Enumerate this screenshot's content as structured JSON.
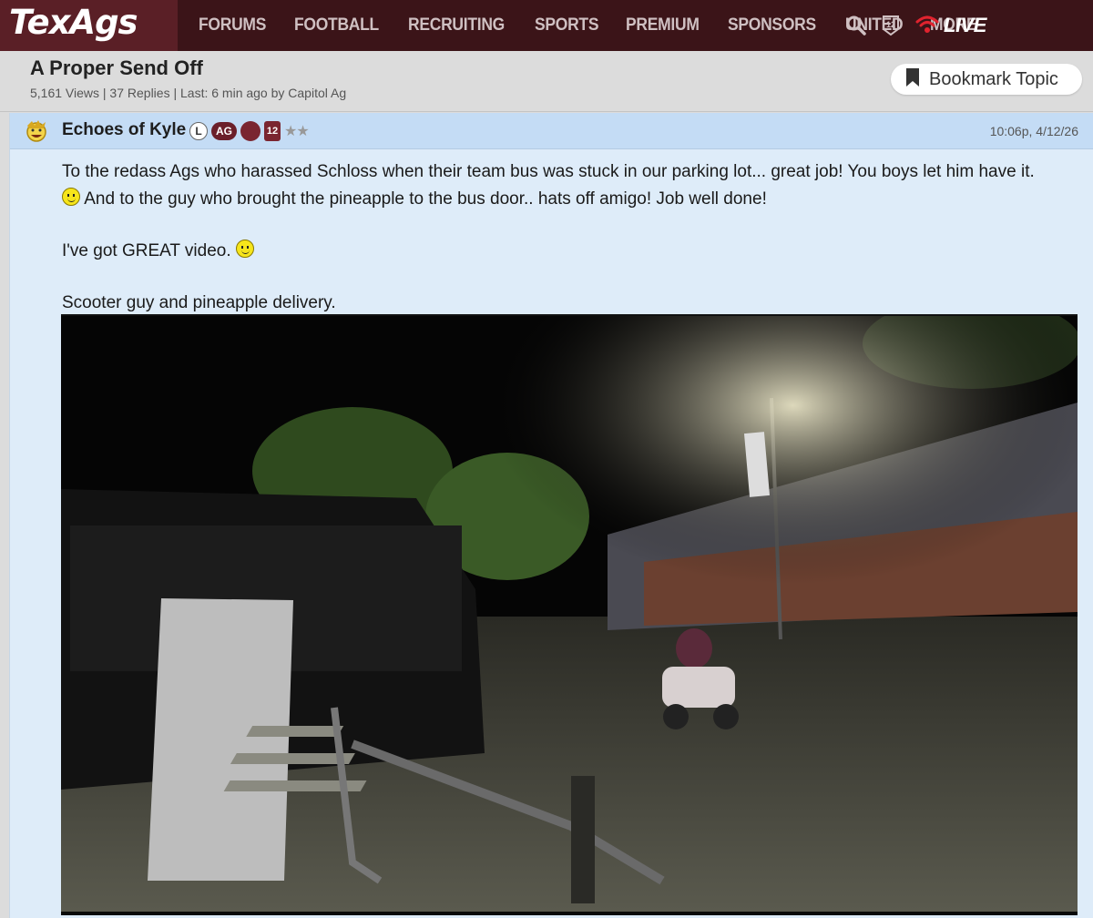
{
  "brand": {
    "logo_text": "TexAgs",
    "primary_color": "#3b1418",
    "accent_color": "#5a1f26"
  },
  "nav": {
    "items": [
      "FORUMS",
      "FOOTBALL",
      "RECRUITING",
      "SPORTS",
      "PREMIUM",
      "SPONSORS",
      "UNITED",
      "MORE"
    ],
    "live_label": "LIVE",
    "icons": [
      "search-icon",
      "sec-logo-icon",
      "live-signal-icon"
    ]
  },
  "topic": {
    "title": "A Proper Send Off",
    "meta": "5,161 Views | 37 Replies | Last: 6 min ago by Capitol Ag",
    "bookmark_label": "Bookmark Topic"
  },
  "post": {
    "username": "Echoes of Kyle",
    "badge_l": "L",
    "badge_ag": "AG",
    "badge_12": "12",
    "stars": "★★",
    "timestamp": "10:06p, 4/12/26",
    "line1": "To the redass Ags who harassed Schloss when their team bus was stuck in our parking lot... great job! You boys let him have it.",
    "line2": " And to the guy who brought the pineapple to the bus door.. hats off amigo! Job well done!",
    "line3": "I've got GREAT video. ",
    "line4": "Scooter guy and pineapple delivery."
  }
}
